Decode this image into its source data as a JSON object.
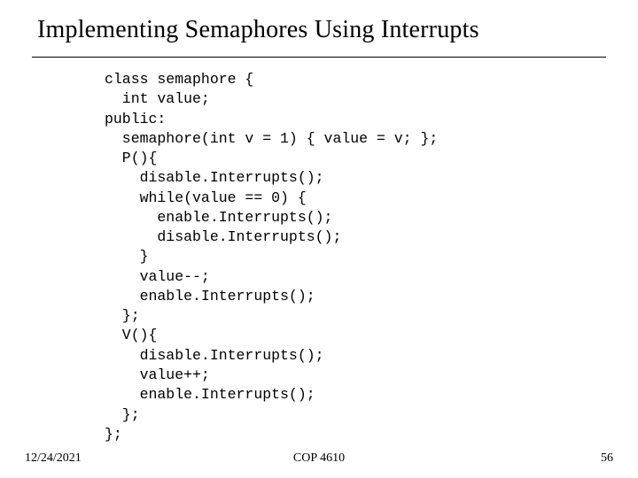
{
  "title": "Implementing Semaphores Using Interrupts",
  "code": "class semaphore {\n  int value;\npublic:\n  semaphore(int v = 1) { value = v; };\n  P(){\n    disable.Interrupts();\n    while(value == 0) {\n      enable.Interrupts();\n      disable.Interrupts();\n    }\n    value--;\n    enable.Interrupts();\n  };\n  V(){\n    disable.Interrupts();\n    value++;\n    enable.Interrupts();\n  };\n};",
  "footer": {
    "date": "12/24/2021",
    "course": "COP 4610",
    "page": "56"
  }
}
